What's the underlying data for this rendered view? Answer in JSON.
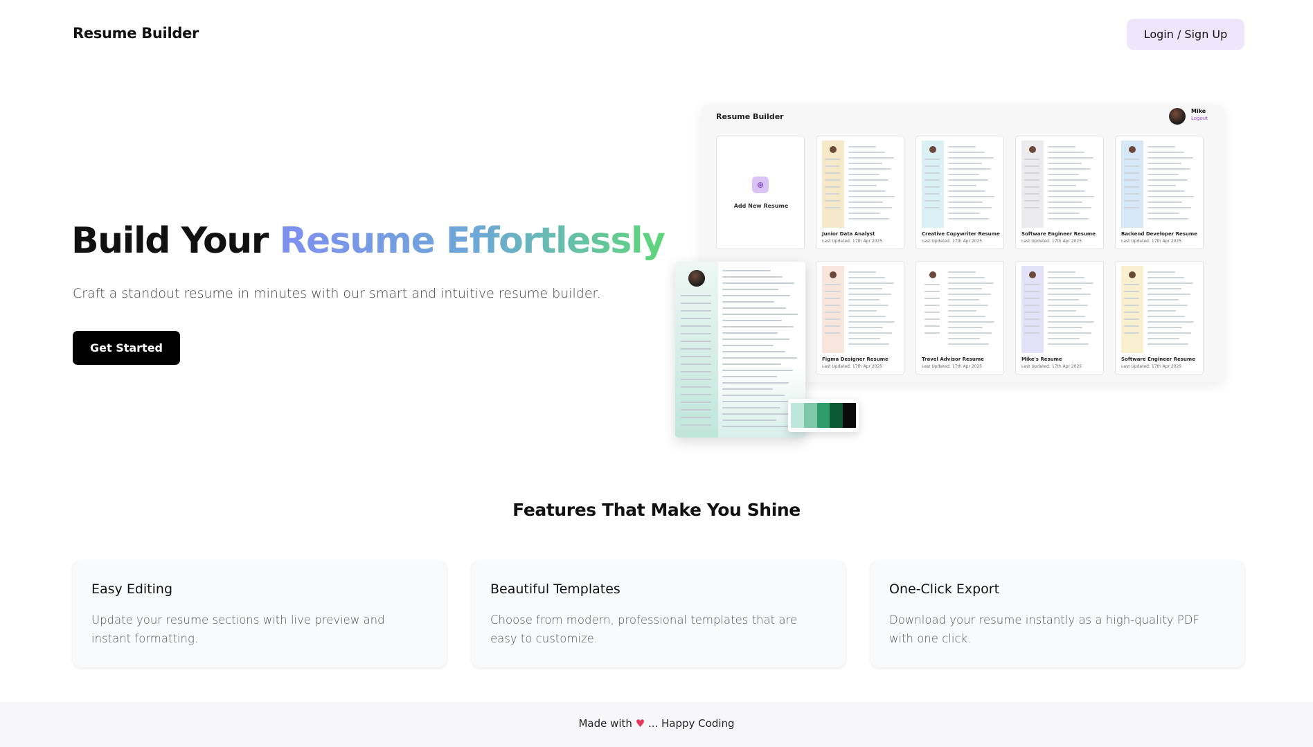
{
  "header": {
    "brand": "Resume Builder",
    "login_label": "Login / Sign Up"
  },
  "hero": {
    "title_plain": "Build Your ",
    "title_highlight": "Resume Effortlessly",
    "subtitle": "Craft a standout resume in minutes with our smart and intuitive resume builder.",
    "cta_label": "Get Started"
  },
  "preview": {
    "app_title": "Resume Builder",
    "user_name": "Mike",
    "logout_label": "Logout",
    "add_label": "Add New Resume",
    "add_icon": "plus-circle-icon",
    "cards": [
      {
        "name": "Junior Data Analyst",
        "date": "Last Updated: 17th Apr 2025",
        "accent": "#f5e9c9"
      },
      {
        "name": "Creative Copywriter Resume",
        "date": "Last Updated: 17th Apr 2025",
        "accent": "#d9f0f5"
      },
      {
        "name": "Software Engineer Resume",
        "date": "Last Updated: 17th Apr 2025",
        "accent": "#ececef"
      },
      {
        "name": "Backend Developer Resume",
        "date": "Last Updated: 17th Apr 2025",
        "accent": "#d6e8f8"
      },
      {
        "name": "Figma Designer Resume",
        "date": "Last Updated: 17th Apr 2025",
        "accent": "#f8e6dc"
      },
      {
        "name": "Travel Advisor Resume",
        "date": "Last Updated: 17th Apr 2025",
        "accent": "#ffffff"
      },
      {
        "name": "Mike's Resume",
        "date": "Last Updated: 17th Apr 2025",
        "accent": "#e4e2f8"
      },
      {
        "name": "Software Engineer Resume",
        "date": "Last Updated: 17th Apr 2025",
        "accent": "#f9f0cf"
      }
    ],
    "palette": [
      "#bfe6da",
      "#7cc8a8",
      "#2f9a6a",
      "#0c5a35",
      "#0a0a0a"
    ]
  },
  "features": {
    "title": "Features That Make You Shine",
    "items": [
      {
        "title": "Easy Editing",
        "text": "Update your resume sections with live preview and instant formatting."
      },
      {
        "title": "Beautiful Templates",
        "text": "Choose from modern, professional templates that are easy to customize."
      },
      {
        "title": "One-Click Export",
        "text": "Download your resume instantly as a high-quality PDF with one click."
      }
    ]
  },
  "footer": {
    "prefix": "Made with",
    "heart": "♥",
    "suffix": "... Happy Coding"
  }
}
